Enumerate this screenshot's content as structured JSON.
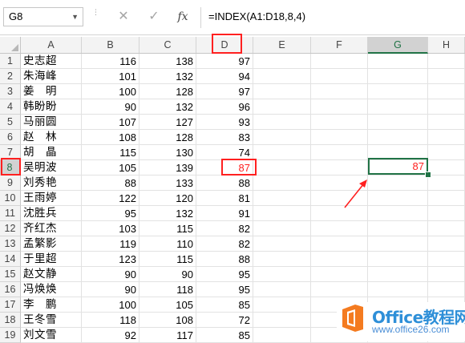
{
  "formula_bar": {
    "name_box": "G8",
    "cancel_symbol": "✕",
    "enter_symbol": "✓",
    "fx_symbol": "fx",
    "formula": "=INDEX(A1:D18,8,4)"
  },
  "columns": [
    "A",
    "B",
    "C",
    "D",
    "E",
    "F",
    "G",
    "H"
  ],
  "selected_column": "G",
  "selected_row": 8,
  "rows": [
    {
      "n": "1",
      "name": "史志超",
      "b": "116",
      "c": "138",
      "d": "97"
    },
    {
      "n": "2",
      "name": "朱海峰",
      "b": "101",
      "c": "132",
      "d": "94"
    },
    {
      "n": "3",
      "name": "姜　明",
      "b": "100",
      "c": "128",
      "d": "97"
    },
    {
      "n": "4",
      "name": "韩盼盼",
      "b": "90",
      "c": "132",
      "d": "96"
    },
    {
      "n": "5",
      "name": "马丽圆",
      "b": "107",
      "c": "127",
      "d": "93"
    },
    {
      "n": "6",
      "name": "赵　林",
      "b": "108",
      "c": "128",
      "d": "83"
    },
    {
      "n": "7",
      "name": "胡　晶",
      "b": "115",
      "c": "130",
      "d": "74"
    },
    {
      "n": "8",
      "name": "吴明波",
      "b": "105",
      "c": "139",
      "d": "87"
    },
    {
      "n": "9",
      "name": "刘秀艳",
      "b": "88",
      "c": "133",
      "d": "88"
    },
    {
      "n": "10",
      "name": "王雨婷",
      "b": "122",
      "c": "120",
      "d": "81"
    },
    {
      "n": "11",
      "name": "沈胜兵",
      "b": "95",
      "c": "132",
      "d": "91"
    },
    {
      "n": "12",
      "name": "齐红杰",
      "b": "103",
      "c": "115",
      "d": "82"
    },
    {
      "n": "13",
      "name": "孟繁影",
      "b": "119",
      "c": "110",
      "d": "82"
    },
    {
      "n": "14",
      "name": "于里超",
      "b": "123",
      "c": "115",
      "d": "88"
    },
    {
      "n": "15",
      "name": "赵文静",
      "b": "90",
      "c": "90",
      "d": "95"
    },
    {
      "n": "16",
      "name": "冯焕焕",
      "b": "90",
      "c": "118",
      "d": "95"
    },
    {
      "n": "17",
      "name": "李　鹏",
      "b": "100",
      "c": "105",
      "d": "85"
    },
    {
      "n": "18",
      "name": "王冬雪",
      "b": "118",
      "c": "108",
      "d": "72"
    },
    {
      "n": "19",
      "name": "刘文雪",
      "b": "92",
      "c": "117",
      "d": "85"
    }
  ],
  "active_cell": {
    "ref": "G8",
    "value": "87"
  },
  "watermark": {
    "title": "Office教程网",
    "url": "www.office26.com"
  },
  "colors": {
    "accent_green": "#217346",
    "highlight_red": "#ff2020",
    "logo_orange": "#f47b20",
    "watermark_blue": "#2e8fd8"
  }
}
